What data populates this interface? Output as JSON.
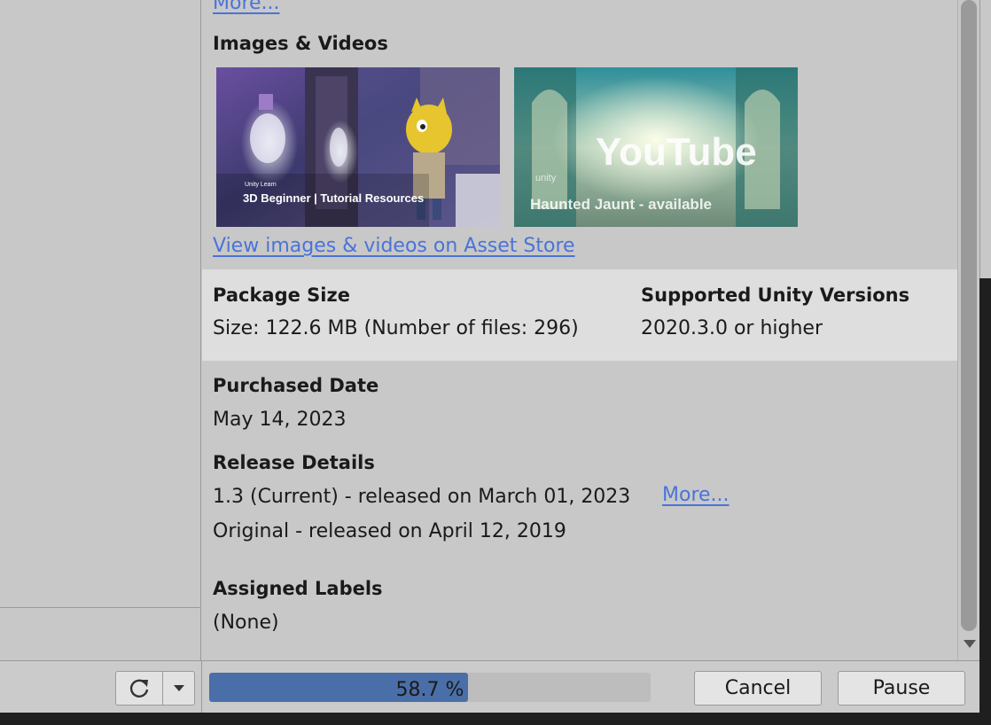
{
  "detail": {
    "top_more_link": "More...",
    "images_title": "Images & Videos",
    "media": [
      {
        "caption_brand": "Unity Learn",
        "caption": "3D Beginner | Tutorial Resources"
      },
      {
        "logo_text": "YouTube",
        "caption_brand": "unity",
        "caption": "Haunted Jaunt - available"
      }
    ],
    "view_media_link": "View images & videos on Asset Store",
    "package_size": {
      "title": "Package Size",
      "value": "Size: 122.6 MB (Number of files: 296)"
    },
    "supported_versions": {
      "title": "Supported Unity Versions",
      "value": "2020.3.0 or higher"
    },
    "purchased": {
      "title": "Purchased Date",
      "value": "May 14, 2023"
    },
    "release": {
      "title": "Release Details",
      "current": "1.3 (Current) - released on March 01, 2023",
      "more_link": "More...",
      "original": "Original - released on April 12, 2019"
    },
    "labels": {
      "title": "Assigned Labels",
      "value": "(None)"
    }
  },
  "bottom_bar": {
    "progress_percent": 58.7,
    "progress_label": "58.7 %",
    "cancel_label": "Cancel",
    "pause_label": "Pause"
  },
  "colors": {
    "link": "#4a73d9",
    "progress_fill": "#4a6fa8",
    "panel_bg": "#c8c8c8",
    "band_bg": "#dedede"
  },
  "icons": {
    "refresh": "refresh-icon",
    "dropdown": "chevron-down-icon"
  }
}
